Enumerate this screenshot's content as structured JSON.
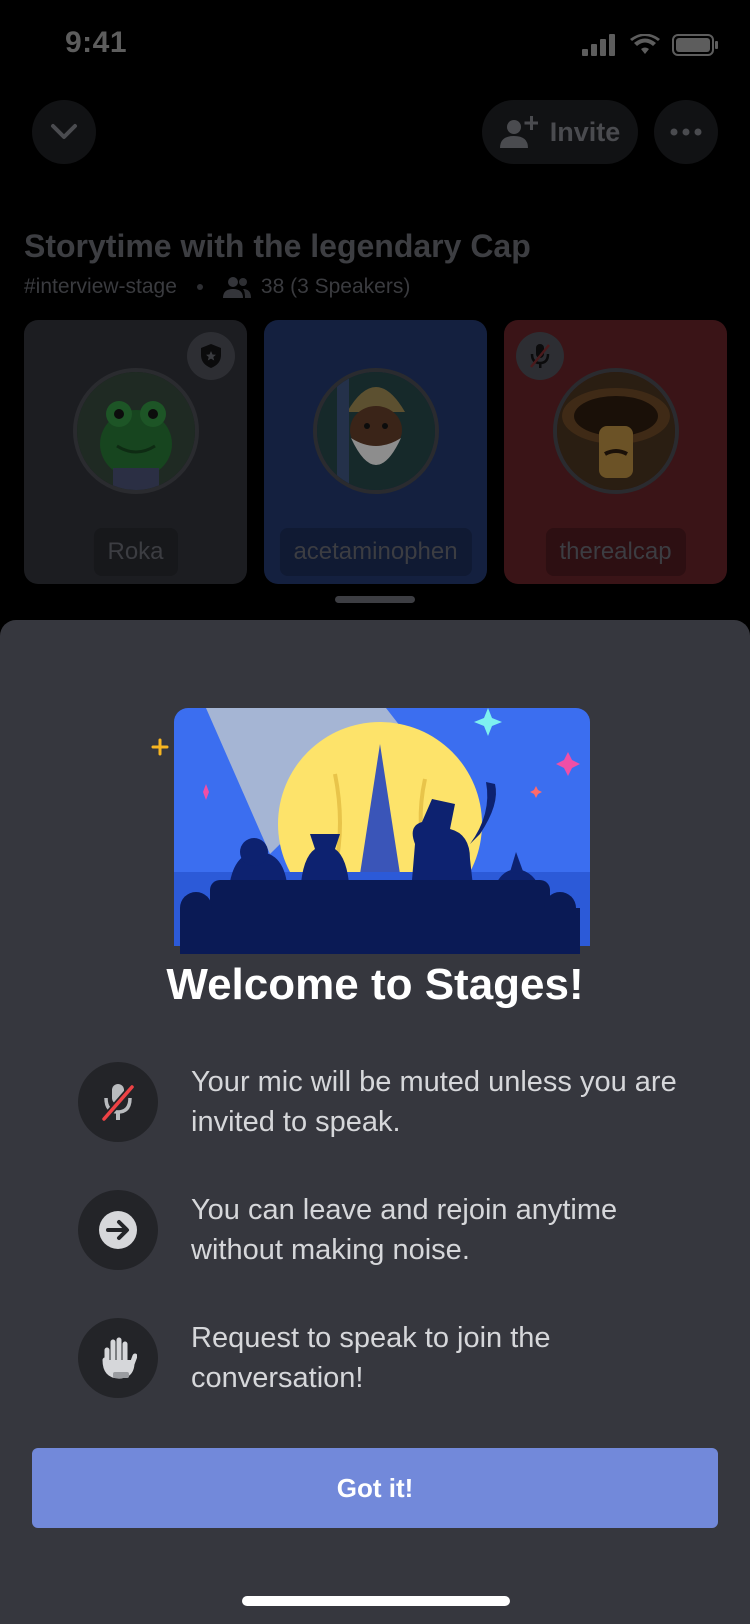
{
  "status_bar": {
    "time": "9:41"
  },
  "header": {
    "invite_label": "Invite"
  },
  "stage": {
    "title": "Storytime with the legendary Cap",
    "channel": "#interview-stage",
    "listeners": "38 (3 Speakers)"
  },
  "speakers": [
    {
      "name": "Roka"
    },
    {
      "name": "acetaminophen"
    },
    {
      "name": "therealcap"
    }
  ],
  "sheet": {
    "title": "Welcome to Stages!",
    "tips": [
      {
        "icon": "mic-muted-icon",
        "text": "Your mic will be muted unless you are invited to speak."
      },
      {
        "icon": "arrow-right-icon",
        "text": "You can leave and rejoin anytime without making noise."
      },
      {
        "icon": "raised-hand-icon",
        "text": "Request to speak to join the conversation!"
      }
    ],
    "button_label": "Got it!"
  },
  "colors": {
    "sheet_bg": "#36373e",
    "button": "#7289da",
    "muted_slash": "#ed4245",
    "hero_blue": "#3b6ef0",
    "hero_moon": "#fde36a"
  }
}
